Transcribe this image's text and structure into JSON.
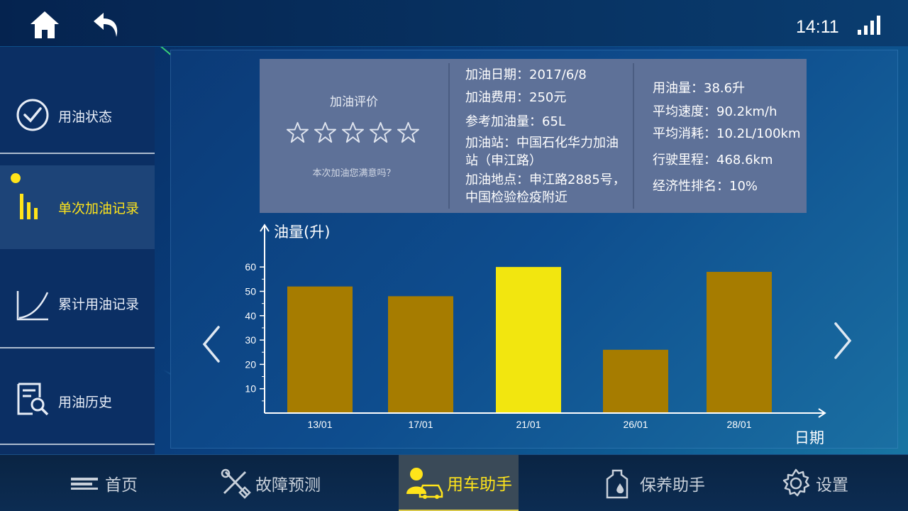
{
  "topbar": {
    "home_icon": "home-icon",
    "back_icon": "back-arrow-icon",
    "time": "14:11",
    "signal_icon": "signal-bars-icon"
  },
  "sidebar": {
    "items": [
      {
        "label": "用油状态",
        "icon": "check-circle-icon"
      },
      {
        "label": "单次加油记录",
        "icon": "bars-icon",
        "active": true
      },
      {
        "label": "累计用油记录",
        "icon": "growth-curve-icon"
      },
      {
        "label": "用油历史",
        "icon": "document-search-icon"
      }
    ]
  },
  "rating": {
    "title": "加油评价",
    "stars": 5,
    "filled": 0,
    "question": "本次加油您满意吗？"
  },
  "refuel": {
    "date": "加油日期：2017/6/8",
    "cost": "加油费用：250元",
    "reference_amount": "参考加油量：65L",
    "station": "加油站：中国石化华力加油站（申江路）",
    "address": "加油地点：申江路2885号，中国检验检疫附近"
  },
  "stats": {
    "fuel_used": "用油量：38.6升",
    "avg_speed": "平均速度：90.2km/h",
    "avg_consumption": "平均消耗：10.2L/100km",
    "mileage": "行驶里程：468.6km",
    "economy_rank": "经济性排名：10%"
  },
  "chart_data": {
    "type": "bar",
    "ylabel": "油量(升)",
    "xlabel": "日期",
    "categories": [
      "13/01",
      "17/01",
      "21/01",
      "26/01",
      "28/01"
    ],
    "values": [
      52,
      48,
      60,
      26,
      58
    ],
    "highlight_index": 2,
    "yticks": [
      10,
      20,
      30,
      40,
      50,
      60
    ],
    "ylim": [
      0,
      70
    ],
    "colors": {
      "bar": "#a67c00",
      "highlight": "#f2e60f",
      "axis": "#ffffff"
    }
  },
  "nav": {
    "prev_icon": "chevron-left-icon",
    "next_icon": "chevron-right-icon"
  },
  "bottombar": {
    "tabs": [
      {
        "label": "首页",
        "icon": "menu-lines-icon"
      },
      {
        "label": "故障预测",
        "icon": "wrench-screwdriver-icon"
      },
      {
        "label": "用车助手",
        "icon": "driver-car-icon",
        "active": true
      },
      {
        "label": "保养助手",
        "icon": "oil-bottle-icon"
      },
      {
        "label": "设置",
        "icon": "gear-icon"
      }
    ]
  }
}
